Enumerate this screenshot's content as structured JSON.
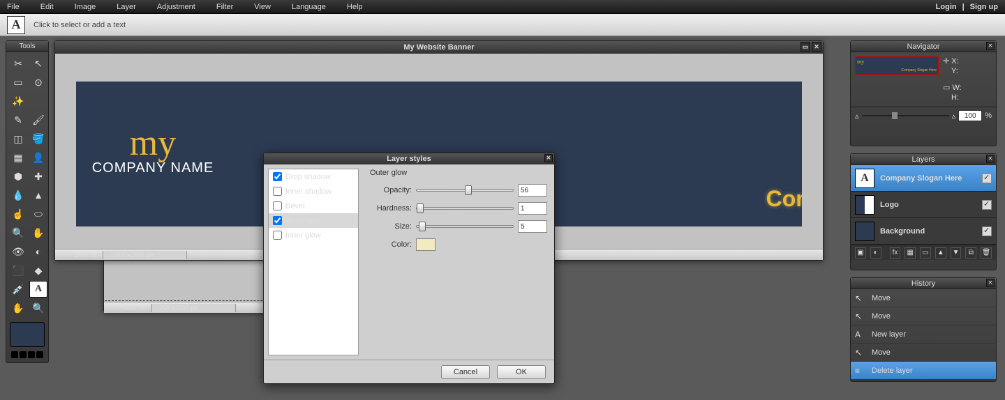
{
  "menu": [
    "File",
    "Edit",
    "Image",
    "Layer",
    "Adjustment",
    "Filter",
    "View",
    "Language",
    "Help"
  ],
  "auth": {
    "login": "Login",
    "sep": "|",
    "signup": "Sign up"
  },
  "optionsbar": {
    "hint": "Click to select or add a text"
  },
  "tools_title": "Tools",
  "doc1": {
    "title": "My Website Banner",
    "zoom": "100",
    "pct": "%",
    "dim": "1000x200 px",
    "logo_my": "my",
    "logo_co": "COMPANY NAME",
    "slogan": "Company Slogan Here"
  },
  "doc2": {
    "zoom": "100",
    "pct": "%",
    "dim": "200x200 px"
  },
  "navigator": {
    "title": "Navigator",
    "x": "X:",
    "y": "Y:",
    "w": "W:",
    "h": "H:",
    "zoom": "100",
    "pct": "%"
  },
  "layers": {
    "title": "Layers",
    "items": [
      {
        "name": "Company Slogan Here",
        "thumb": "A",
        "sel": true
      },
      {
        "name": "Logo",
        "thumb": "",
        "sel": false
      },
      {
        "name": "Background",
        "thumb": "",
        "sel": false
      }
    ]
  },
  "history": {
    "title": "History",
    "items": [
      {
        "label": "Move",
        "icon": "↖",
        "sel": false
      },
      {
        "label": "Move",
        "icon": "↖",
        "sel": false
      },
      {
        "label": "New layer",
        "icon": "A",
        "sel": false
      },
      {
        "label": "Move",
        "icon": "↖",
        "sel": false
      },
      {
        "label": "Delete layer",
        "icon": "≡",
        "sel": true
      }
    ]
  },
  "dialog": {
    "title": "Layer styles",
    "styles": [
      {
        "label": "Drop shadow",
        "checked": true,
        "sel": false
      },
      {
        "label": "Inner shadow",
        "checked": false,
        "sel": false
      },
      {
        "label": "Bevel",
        "checked": false,
        "sel": false
      },
      {
        "label": "Outer glow",
        "checked": true,
        "sel": true
      },
      {
        "label": "Inner glow",
        "checked": false,
        "sel": false
      }
    ],
    "section": "Outer glow",
    "opacity_label": "Opacity:",
    "opacity": "56",
    "opacity_pos": "50%",
    "hardness_label": "Hardness:",
    "hardness": "1",
    "hardness_pos": "0%",
    "size_label": "Size:",
    "size": "5",
    "size_pos": "2%",
    "color_label": "Color:",
    "cancel": "Cancel",
    "ok": "OK"
  }
}
